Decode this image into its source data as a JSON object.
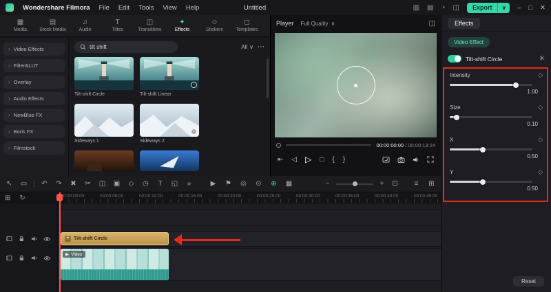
{
  "colors": {
    "accent": "#35d6a8",
    "annotation": "#e8281e",
    "clip_effect": "#c8a05e",
    "clip_video": "#3fae9e"
  },
  "menubar": {
    "app_name": "Wondershare Filmora",
    "menus": [
      "File",
      "Edit",
      "Tools",
      "View",
      "Help"
    ],
    "project_title": "Untitled",
    "export_label": "Export",
    "export_caret": "∨",
    "icons": {
      "screen_record": "▥",
      "snapshot": "▤",
      "notification": "◔",
      "layout": "◫"
    },
    "window": {
      "min": "–",
      "max": "□",
      "close": "✕"
    }
  },
  "media_tabs": {
    "items": [
      {
        "icon": "▦",
        "label": "Media"
      },
      {
        "icon": "▤",
        "label": "Stock Media"
      },
      {
        "icon": "♫",
        "label": "Audio"
      },
      {
        "icon": "T",
        "label": "Titles"
      },
      {
        "icon": "◫",
        "label": "Transitions"
      },
      {
        "icon": "✦",
        "label": "Effects"
      },
      {
        "icon": "☺",
        "label": "Stickers"
      },
      {
        "icon": "◻",
        "label": "Templates"
      }
    ]
  },
  "sidebar": {
    "chevron": "›",
    "items": [
      "Video Effects",
      "Filter&LUT",
      "Overlay",
      "Audio Effects",
      "NewBlue FX",
      "Boris FX",
      "Filmstock"
    ]
  },
  "search": {
    "value": "tilt shift",
    "filter_label": "All",
    "filter_caret": "∨",
    "more": "⋯"
  },
  "effects_grid": {
    "download_glyph": "↓",
    "items": [
      {
        "name": "Tilt-shift Circle"
      },
      {
        "name": "Tilt-shift Linear"
      },
      {
        "name": "Sideways 1"
      },
      {
        "name": "Sideways 2"
      }
    ]
  },
  "player": {
    "label": "Player",
    "quality": "Full Quality",
    "quality_caret": "∨",
    "panel_icon": "◫",
    "current_time": "00:00:00:00",
    "time_separator": "/",
    "total_time": "00:00:13:24",
    "controls": {
      "step_back": "⇤",
      "prev_frame": "◁",
      "play": "▷",
      "stop": "□",
      "mark_in": "{",
      "mark_out": "}"
    }
  },
  "inspector": {
    "tab": "Effects",
    "subtab": "Video Effect",
    "effect_name": "Tilt-shift Circle",
    "gear_icon": "✳",
    "keyframe_icon": "◇",
    "params": [
      {
        "label": "Intensity",
        "value": "1.00",
        "percent": 80
      },
      {
        "label": "Size",
        "value": "0.10",
        "percent": 8
      },
      {
        "label": "X",
        "value": "0.50",
        "percent": 40
      },
      {
        "label": "Y",
        "value": "0.50",
        "percent": 40
      }
    ],
    "reset_label": "Reset"
  },
  "timeline": {
    "toolbar": {
      "pointer": "↖",
      "trim": "▭",
      "undo": "↶",
      "redo": "↷",
      "delete": "✖",
      "scissors": "✂",
      "split": "◫",
      "crop": "▣",
      "keyframe": "◇",
      "speed": "◷",
      "text": "T",
      "pip": "◱",
      "more": "»",
      "render": "▶",
      "marker": "⚑",
      "mask": "◎",
      "chroma": "⊙",
      "motion_track": "⊕",
      "snapshot": "▦",
      "zoom_out": "−",
      "zoom_in": "+",
      "fit": "⊡",
      "track_menu": "≡",
      "grid": "⊞"
    },
    "corner": {
      "add_track": "⊞",
      "refresh": "↻"
    },
    "ruler": [
      "00:00:00:00",
      "00:00:05:00",
      "00:00:10:00",
      "00:00:15:00",
      "00:00:20:00",
      "00:00:25:00",
      "00:00:30:00",
      "00:00:35:00",
      "00:00:40:00",
      "00:00:45:00"
    ],
    "clips": [
      {
        "icon": "✦",
        "name": "Tilt-shift Circle"
      },
      {
        "icon": "▶",
        "name": "Video"
      }
    ]
  }
}
